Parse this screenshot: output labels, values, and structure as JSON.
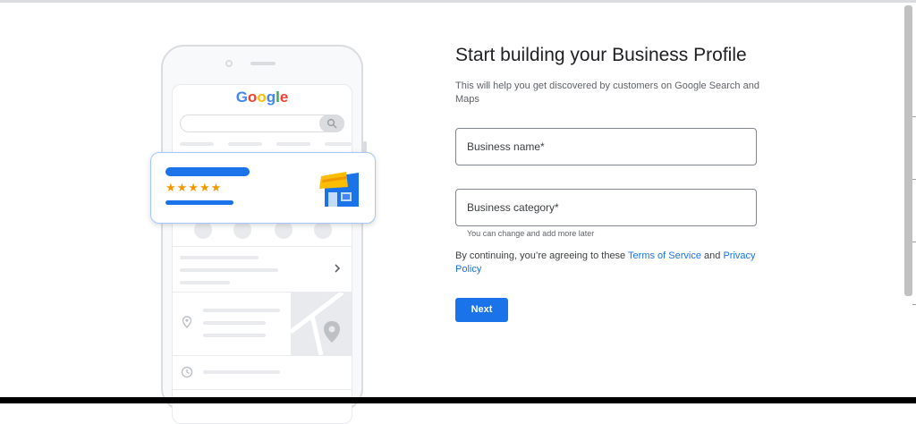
{
  "illustration": {
    "logo_letters": [
      {
        "char": "G",
        "color": "#4285f4"
      },
      {
        "char": "o",
        "color": "#ea4335"
      },
      {
        "char": "o",
        "color": "#fbbc05"
      },
      {
        "char": "g",
        "color": "#4285f4"
      },
      {
        "char": "l",
        "color": "#34a853"
      },
      {
        "char": "e",
        "color": "#ea4335"
      }
    ],
    "stars": "★★★★★",
    "rating_stars": 5,
    "star_color": "#f29900",
    "accent_color": "#1a73e8",
    "icons": [
      "search-icon",
      "phone-icon",
      "directions-icon",
      "bookmark-icon",
      "share-icon",
      "chevron-right-icon",
      "location-pin-icon",
      "clock-icon",
      "storefront-icon"
    ]
  },
  "form": {
    "title": "Start building your Business Profile",
    "subtitle": "This will help you get discovered by customers on Google Search and Maps",
    "business_name_label": "Business name*",
    "business_category_label": "Business category*",
    "category_helper": "You can change and add more later",
    "legal_prefix": "By continuing, you’re agreeing to these ",
    "terms_link": "Terms of Service",
    "legal_and": " and ",
    "privacy_link": "Privacy Policy",
    "next_label": "Next"
  },
  "colors": {
    "primary": "#1a73e8",
    "text": "#202124",
    "secondary_text": "#5f6368"
  }
}
